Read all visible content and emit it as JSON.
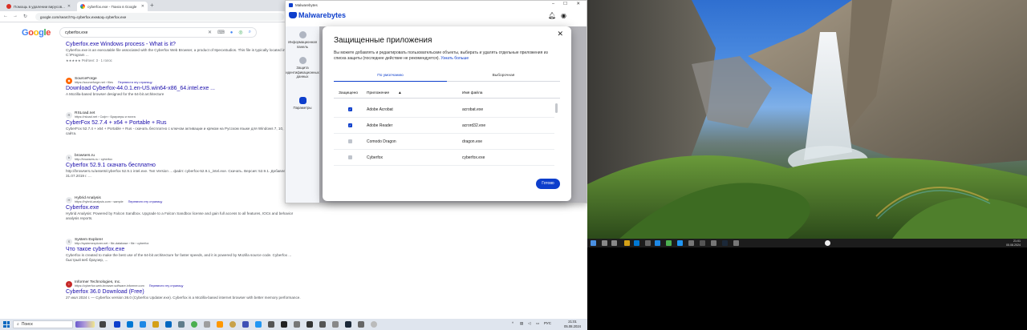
{
  "browser": {
    "tabs": [
      {
        "label": "Помощь в удалении вирусов..."
      },
      {
        "label": "cyberfox.exe - Поиск в Google"
      }
    ],
    "url": "google.com/search?q=cyberfox.exe&oq=cyberfox.exe",
    "logo": "Google",
    "query": "cyberfox.exe"
  },
  "results": [
    {
      "site": "",
      "url": "",
      "title": "Cyberfox.exe Windows process - What is it?",
      "snippet": "Cyberfox.exe is an executable file associated with the Cyberfox Web Browser, a product of 8pecxstudios. This file is typically located in the C:\\Program ...",
      "rating": "★★★★★ Рейтинг: 3 · 1 голос",
      "translate": ""
    },
    {
      "site": "SourceForge",
      "url": "https://sourceforge.net › files",
      "title": "Download Cyberfox-44.0.1.en-US.win64-x86_64.intel.exe ...",
      "snippet": "A Mozilla-based browser designed for the 64-bit architecture",
      "rating": "",
      "translate": "Перевести эту страницу"
    },
    {
      "site": "RSLoad.net",
      "url": "https://rsload.net › Софт › Браузеры и почта",
      "title": "CyberFox 52.7.4 + x64 + Portable + Rus",
      "snippet": "CyberFox 52.7.4 + x64 + Portable + Rus - скачать бесплатно с ключом активации и кряком на Русском языке для Windows 7, 10, 11 с нашего сайта.",
      "rating": "",
      "translate": ""
    },
    {
      "site": "browsers.ru",
      "url": "http://browsers.ru › cyberfox",
      "title": "Cyberfox 52.9.1 скачать бесплатно",
      "snippet": "http://browsers.ru/assets/cyberfox 52.9.1 intel.exe. Тип Version ... файл: cyberfox-52.9.1_intel.exe. Скачать. Версия: 52.9.1. Добавлено: 31.07.2019 г. ...",
      "rating": "",
      "translate": ""
    },
    {
      "site": "Hybrid Analysis",
      "url": "https://hybrid-analysis.com › sample",
      "title": "Cyberfox.exe",
      "snippet": "Hybrid Analysis: Powered by Falcon Sandbox. Upgrade to a Falcon Sandbox license and gain full access to all features, IOCs and behavior analysis reports.",
      "rating": "",
      "translate": "Перевести эту страницу"
    },
    {
      "site": "System Explorer",
      "url": "http://systemexplorer.net › file-database › file › cyberfox",
      "title": "Что такое cyberfox.exe",
      "snippet": "Cyberfox is created to make the best use of the 64-bit architecture for faster speeds, and it is powered by Mozilla source code. Cyberfox ... быстрый веб браузер, ...",
      "rating": "",
      "translate": ""
    },
    {
      "site": "Informer Technologies, Inc.",
      "url": "https://cyberfox.web-browser.software.informer.com",
      "title": "Cyberfox 36.0 Download (Free)",
      "snippet": "27 июл 2024 г. — Cyberfox version 36.0 (Cyberfox Updater.exe). Cyberfox is a Mozilla-based internet browser with better memory performance.",
      "rating": "",
      "translate": "Перевести эту страницу"
    }
  ],
  "malwarebytes": {
    "window_title": "Malwarebytes",
    "brand": "Malwarebytes",
    "sidebar": [
      {
        "label": "Информационная панель"
      },
      {
        "label": "Защита идентификационных данных"
      },
      {
        "label": "Параметры"
      }
    ],
    "dialog": {
      "title": "Защищенные приложения",
      "description": "Вы можете добавлять и редактировать пользовательские объекты, выбирать и удалять отдельные приложения из списка защиты (последнее действие не рекомендуется).",
      "learn_more": "Узнать больше",
      "tabs": [
        "По умолчанию",
        "Выборочная"
      ],
      "columns": {
        "protected": "Защищено",
        "app": "Приложение",
        "file": "Имя файла"
      },
      "rows": [
        {
          "app": "Adobe Acrobat",
          "file": "acrobat.exe",
          "checked": true
        },
        {
          "app": "Adobe Reader",
          "file": "acrord32.exe",
          "checked": true
        },
        {
          "app": "Comodo Dragon",
          "file": "dragon.exe",
          "checked": false
        },
        {
          "app": "Cyberfox",
          "file": "cyberfox.exe",
          "checked": false
        }
      ],
      "done_label": "Готово"
    }
  },
  "taskbar_left": {
    "search_placeholder": "Поиск",
    "lang": "РУС",
    "time": "21:01",
    "date": "05.08.2024"
  },
  "taskbar_right": {
    "time": "21:01",
    "date": "05.08.2024"
  },
  "colors": {
    "accent": "#0d3ecc",
    "link": "#1a0dab"
  }
}
